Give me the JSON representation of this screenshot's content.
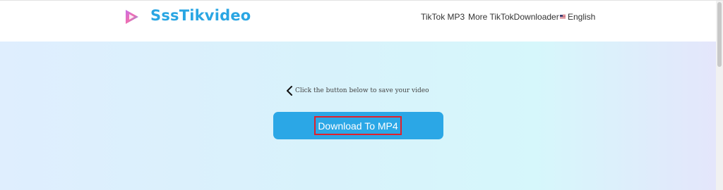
{
  "header": {
    "brand": "SssTikvideo",
    "nav": {
      "mp3": "TikTok MP3",
      "more": "More TikTokDownloader",
      "language": "English"
    }
  },
  "main": {
    "hint": "Click the button below to save your video",
    "download_button": "Download To MP4"
  },
  "colors": {
    "brand": "#2aa6e3",
    "button": "#2ba7e6",
    "highlight_border": "#e2202a"
  },
  "icons": {
    "logo": "play-logo-icon",
    "back": "chevron-left-icon",
    "flag": "us-flag-icon"
  }
}
